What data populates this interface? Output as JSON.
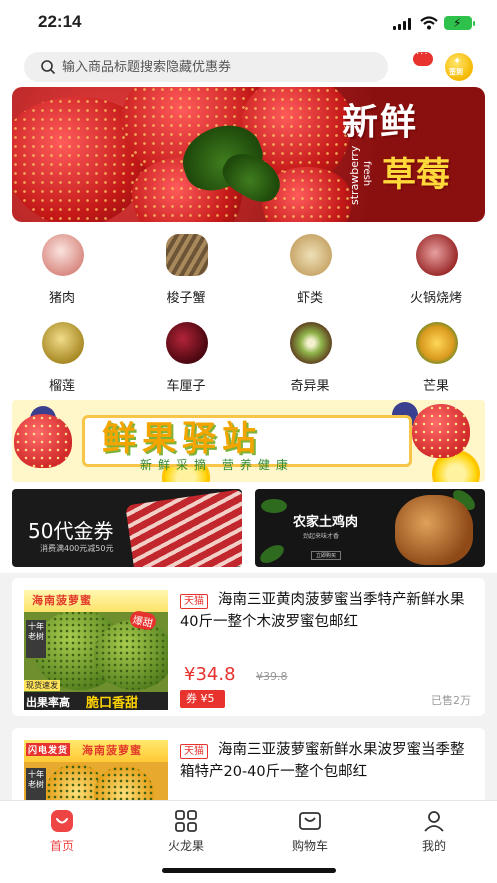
{
  "status_bar": {
    "time": "22:14"
  },
  "search": {
    "placeholder": "输入商品标题搜索隐藏优惠券"
  },
  "header": {
    "signin_label": "签到",
    "signin_icon": "coin-icon",
    "message_icon": "message-icon"
  },
  "hero_banner": {
    "title_line1": "新鲜",
    "title_line2": "草莓",
    "en_line1": "fresh",
    "en_line2": "strawberry"
  },
  "categories": [
    {
      "label": "猪肉",
      "icon": "pork-icon",
      "color": "#f2c6c0"
    },
    {
      "label": "梭子蟹",
      "icon": "crab-icon",
      "color": "#8a6f4d"
    },
    {
      "label": "虾类",
      "icon": "shrimp-icon",
      "color": "#d8c08e"
    },
    {
      "label": "火锅烧烤",
      "icon": "hotpot-meat-icon",
      "color": "#c45b5b"
    },
    {
      "label": "榴莲",
      "icon": "durian-icon",
      "color": "#c9a63e"
    },
    {
      "label": "车厘子",
      "icon": "cherry-icon",
      "color": "#6b0f1a"
    },
    {
      "label": "奇异果",
      "icon": "kiwi-icon",
      "color": "#8fb34a"
    },
    {
      "label": "芒果",
      "icon": "mango-icon",
      "color": "#e8b23a"
    }
  ],
  "promo_banner": {
    "title": "鲜果驿站",
    "subtitle": "新鲜采摘 营养健康"
  },
  "coupons": {
    "left": {
      "title": "50代金券",
      "subtitle": "消费满400元减50元"
    },
    "right": {
      "title": "农家土鸡肉",
      "subtitle": "劲起来味才香",
      "button": "立即购买"
    }
  },
  "products": [
    {
      "tag": "天猫",
      "title": "海南三亚黄肉菠萝蜜当季特产新鲜水果40斤一整个木波罗蜜包邮红",
      "price": "¥34.8",
      "original_price": "¥39.8",
      "coupon": "券 ¥5",
      "sold": "已售2万",
      "thumb": {
        "top_text": "海南菠萝蜜",
        "badge": "十年老树",
        "bottom_left": "出果率高",
        "bottom_right": "脆口香甜",
        "ribbon": "现货速发",
        "hot": "爆甜"
      }
    },
    {
      "tag": "天猫",
      "title": "海南三亚菠萝蜜新鲜水果波罗蜜当季整箱特产20-40斤一整个包邮红",
      "thumb": {
        "top_text": "海南菠萝蜜",
        "badge": "十年老树",
        "ribbon": "闪电发货"
      }
    }
  ],
  "tabbar": [
    {
      "label": "首页",
      "icon": "home-smile-icon",
      "active": true
    },
    {
      "label": "火龙果",
      "icon": "grid-icon",
      "active": false
    },
    {
      "label": "购物车",
      "icon": "cart-icon",
      "active": false
    },
    {
      "label": "我的",
      "icon": "user-icon",
      "active": false
    }
  ],
  "colors": {
    "accent": "#ef4444",
    "price": "#e8322d",
    "signin": "#f5b800",
    "battery": "#2ec14b"
  }
}
